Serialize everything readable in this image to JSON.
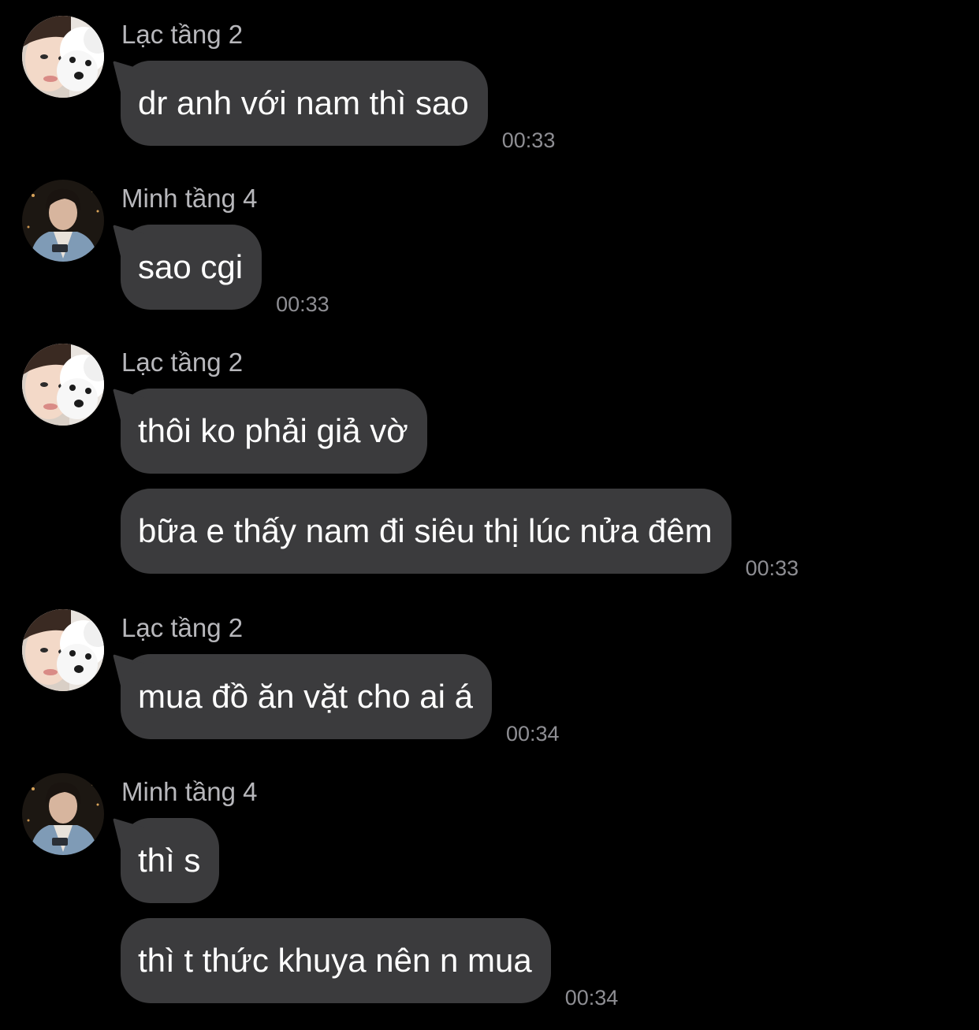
{
  "chat": {
    "groups": [
      {
        "sender": "Lạc tầng 2",
        "avatar": "girl-with-dog-avatar",
        "messages": [
          {
            "text": "dr anh với nam thì sao",
            "time": "00:33"
          }
        ]
      },
      {
        "sender": "Minh tầng 4",
        "avatar": "boy-with-phone-avatar",
        "messages": [
          {
            "text": "sao cgi",
            "time": "00:33"
          }
        ]
      },
      {
        "sender": "Lạc tầng 2",
        "avatar": "girl-with-dog-avatar",
        "messages": [
          {
            "text": "thôi ko phải giả vờ",
            "time": ""
          },
          {
            "text": "bữa e thấy nam đi siêu thị lúc nửa đêm",
            "time": "00:33"
          }
        ]
      },
      {
        "sender": "Lạc tầng 2",
        "avatar": "girl-with-dog-avatar",
        "messages": [
          {
            "text": "mua đồ ăn vặt cho ai á",
            "time": "00:34"
          }
        ]
      },
      {
        "sender": "Minh tầng 4",
        "avatar": "boy-with-phone-avatar",
        "messages": [
          {
            "text": "thì s",
            "time": ""
          },
          {
            "text": "thì t thức khuya nên n mua",
            "time": "00:34"
          }
        ]
      }
    ]
  },
  "colors": {
    "background": "#000000",
    "bubble": "#3b3b3d",
    "sender_name": "#b7b7bb",
    "timestamp": "#8e8e93"
  }
}
